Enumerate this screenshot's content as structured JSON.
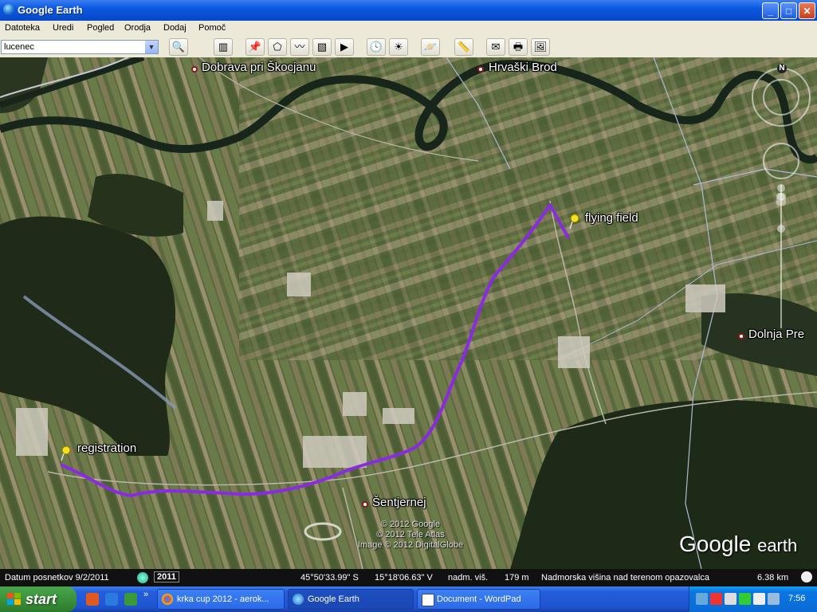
{
  "window": {
    "title": "Google Earth",
    "btn_min": "_",
    "btn_max": "□",
    "btn_close": "✕"
  },
  "menu": [
    "Datoteka",
    "Uredi",
    "Pogled",
    "Orodja",
    "Dodaj",
    "Pomoč"
  ],
  "search": {
    "value": "lucenec",
    "dropdown": "▼"
  },
  "toolbar_icons": [
    "search-icon",
    "sidebar-toggle-icon",
    "add-placemark-icon",
    "add-polygon-icon",
    "add-path-icon",
    "add-image-overlay-icon",
    "record-tour-icon",
    "historical-imagery-icon",
    "sun-icon",
    "switch-planet-icon",
    "ruler-icon",
    "email-icon",
    "print-icon",
    "save-image-icon"
  ],
  "map": {
    "places": {
      "dobrava": "Dobrava pri Škocjanu",
      "hrvaski_brod": "Hrvaški Brod",
      "dolnja_pre": "Dolnja Pre",
      "sentjernej": "Šentjernej"
    },
    "placemarks": {
      "flying_field": "flying field",
      "registration": "registration"
    },
    "copyright": [
      "© 2012 Google",
      "© 2012 Tele Atlas",
      "Image © 2012 DigitalGlobe"
    ],
    "logo": {
      "main": "Google",
      "sub": "earth"
    },
    "compass_letter": "N"
  },
  "status": {
    "imagery_date": "Datum posnetkov 9/2/2011",
    "year": "2011",
    "lat": "45°50'33.99\" S",
    "lon": "15°18'06.63\" V",
    "elev_label": "nadm. viš.",
    "elev": "179 m",
    "eye_label": "Nadmorska višina nad terenom opazovalca",
    "eye": "6.38 km"
  },
  "taskbar": {
    "start": "start",
    "quicklaunch_more": "»",
    "tasks": [
      {
        "label": "krka cup 2012 - aerok...",
        "active": false
      },
      {
        "label": "Google Earth",
        "active": true
      },
      {
        "label": "Document - WordPad",
        "active": false
      }
    ],
    "clock": "7:56"
  },
  "colors": {
    "route": "#8a2be2",
    "titlebar": "#0a58e0",
    "taskbar": "#245edb"
  }
}
